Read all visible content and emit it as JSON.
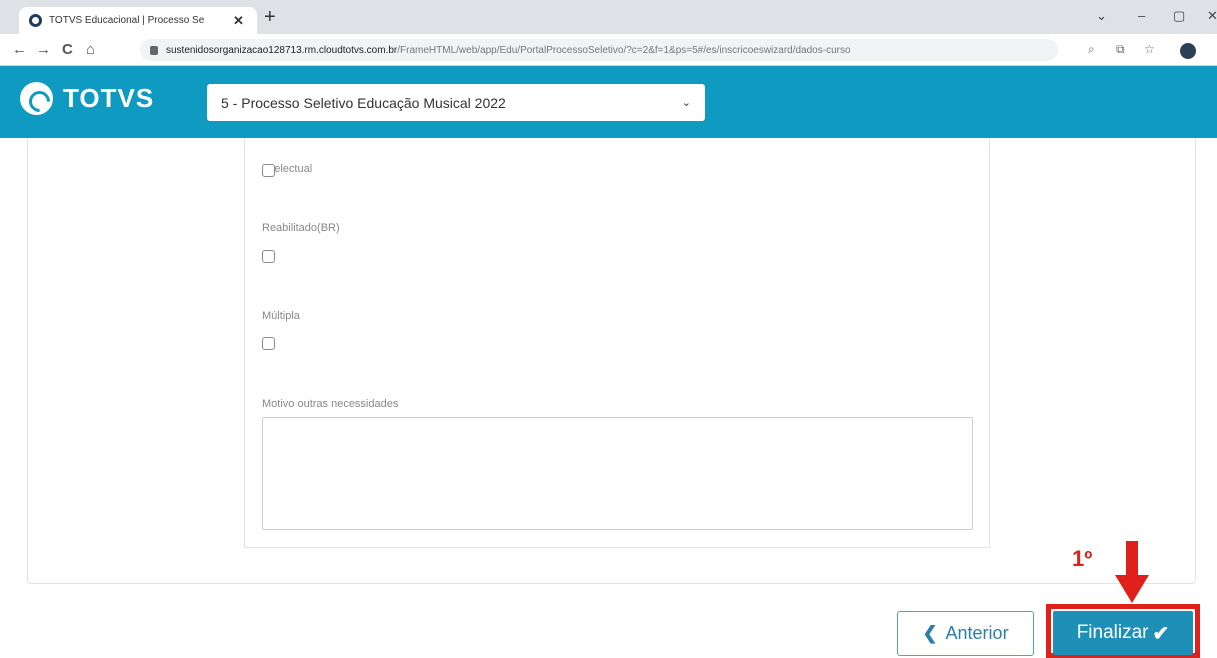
{
  "browser": {
    "tab_title": "TOTVS Educacional | Processo Se",
    "tab_close": "✕",
    "new_tab": "+",
    "url_host": "sustenidosorganizacao128713.rm.cloudtotvs.com.br",
    "url_path": "/FrameHTML/web/app/Edu/PortalProcessoSeletivo/?c=2&f=1&ps=5#/es/inscricoeswizard/dados-curso",
    "window_controls": [
      "⌄",
      "–",
      "▢",
      "✕"
    ],
    "nav_icons": [
      "←",
      "→",
      "C",
      "⌂"
    ],
    "toolbar_icons": [
      "⌕",
      "⧉",
      "☆"
    ]
  },
  "header": {
    "brand": "TOTVS",
    "process_select_value": "5 - Processo Seletivo Educação Musical 2022",
    "select_arrow": "⌄"
  },
  "form": {
    "fields": [
      {
        "label": "Intelectual",
        "checked": false
      },
      {
        "label": "Reabilitado(BR)",
        "checked": false
      },
      {
        "label": "Múltipla",
        "checked": false
      }
    ],
    "textarea_label": "Motivo outras necessidades",
    "textarea_value": ""
  },
  "annotation": {
    "label": "1º",
    "color": "#e0201b"
  },
  "footer": {
    "prev_icon": "❮",
    "prev_label": "Anterior",
    "finish_label": "Finalizar",
    "finish_icon": "✔"
  },
  "colors": {
    "header": "#0f9bc1",
    "primary_button": "#1e90b8",
    "highlight": "#e0201b"
  }
}
